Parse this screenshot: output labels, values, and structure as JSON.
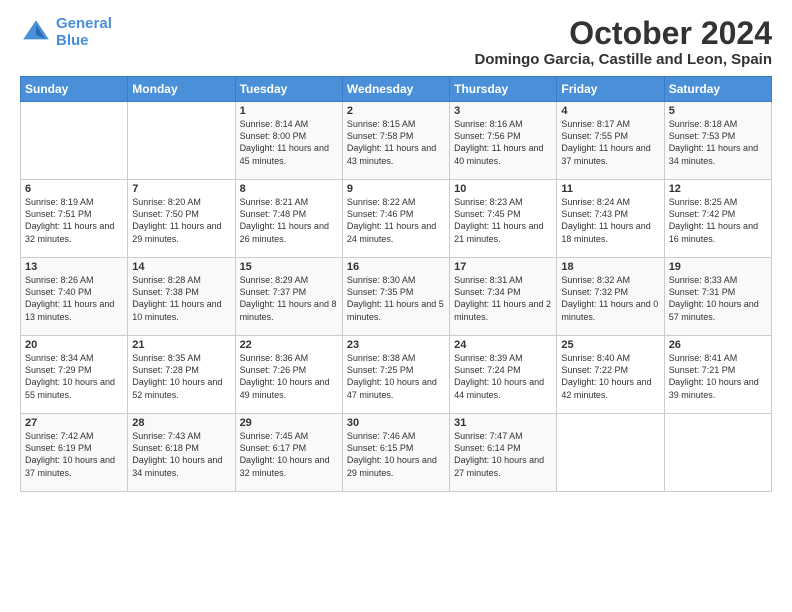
{
  "header": {
    "logo_line1": "General",
    "logo_line2": "Blue",
    "title": "October 2024",
    "subtitle": "Domingo Garcia, Castille and Leon, Spain"
  },
  "weekdays": [
    "Sunday",
    "Monday",
    "Tuesday",
    "Wednesday",
    "Thursday",
    "Friday",
    "Saturday"
  ],
  "weeks": [
    [
      {
        "day": "",
        "sunrise": "",
        "sunset": "",
        "daylight": ""
      },
      {
        "day": "",
        "sunrise": "",
        "sunset": "",
        "daylight": ""
      },
      {
        "day": "1",
        "sunrise": "Sunrise: 8:14 AM",
        "sunset": "Sunset: 8:00 PM",
        "daylight": "Daylight: 11 hours and 45 minutes."
      },
      {
        "day": "2",
        "sunrise": "Sunrise: 8:15 AM",
        "sunset": "Sunset: 7:58 PM",
        "daylight": "Daylight: 11 hours and 43 minutes."
      },
      {
        "day": "3",
        "sunrise": "Sunrise: 8:16 AM",
        "sunset": "Sunset: 7:56 PM",
        "daylight": "Daylight: 11 hours and 40 minutes."
      },
      {
        "day": "4",
        "sunrise": "Sunrise: 8:17 AM",
        "sunset": "Sunset: 7:55 PM",
        "daylight": "Daylight: 11 hours and 37 minutes."
      },
      {
        "day": "5",
        "sunrise": "Sunrise: 8:18 AM",
        "sunset": "Sunset: 7:53 PM",
        "daylight": "Daylight: 11 hours and 34 minutes."
      }
    ],
    [
      {
        "day": "6",
        "sunrise": "Sunrise: 8:19 AM",
        "sunset": "Sunset: 7:51 PM",
        "daylight": "Daylight: 11 hours and 32 minutes."
      },
      {
        "day": "7",
        "sunrise": "Sunrise: 8:20 AM",
        "sunset": "Sunset: 7:50 PM",
        "daylight": "Daylight: 11 hours and 29 minutes."
      },
      {
        "day": "8",
        "sunrise": "Sunrise: 8:21 AM",
        "sunset": "Sunset: 7:48 PM",
        "daylight": "Daylight: 11 hours and 26 minutes."
      },
      {
        "day": "9",
        "sunrise": "Sunrise: 8:22 AM",
        "sunset": "Sunset: 7:46 PM",
        "daylight": "Daylight: 11 hours and 24 minutes."
      },
      {
        "day": "10",
        "sunrise": "Sunrise: 8:23 AM",
        "sunset": "Sunset: 7:45 PM",
        "daylight": "Daylight: 11 hours and 21 minutes."
      },
      {
        "day": "11",
        "sunrise": "Sunrise: 8:24 AM",
        "sunset": "Sunset: 7:43 PM",
        "daylight": "Daylight: 11 hours and 18 minutes."
      },
      {
        "day": "12",
        "sunrise": "Sunrise: 8:25 AM",
        "sunset": "Sunset: 7:42 PM",
        "daylight": "Daylight: 11 hours and 16 minutes."
      }
    ],
    [
      {
        "day": "13",
        "sunrise": "Sunrise: 8:26 AM",
        "sunset": "Sunset: 7:40 PM",
        "daylight": "Daylight: 11 hours and 13 minutes."
      },
      {
        "day": "14",
        "sunrise": "Sunrise: 8:28 AM",
        "sunset": "Sunset: 7:38 PM",
        "daylight": "Daylight: 11 hours and 10 minutes."
      },
      {
        "day": "15",
        "sunrise": "Sunrise: 8:29 AM",
        "sunset": "Sunset: 7:37 PM",
        "daylight": "Daylight: 11 hours and 8 minutes."
      },
      {
        "day": "16",
        "sunrise": "Sunrise: 8:30 AM",
        "sunset": "Sunset: 7:35 PM",
        "daylight": "Daylight: 11 hours and 5 minutes."
      },
      {
        "day": "17",
        "sunrise": "Sunrise: 8:31 AM",
        "sunset": "Sunset: 7:34 PM",
        "daylight": "Daylight: 11 hours and 2 minutes."
      },
      {
        "day": "18",
        "sunrise": "Sunrise: 8:32 AM",
        "sunset": "Sunset: 7:32 PM",
        "daylight": "Daylight: 11 hours and 0 minutes."
      },
      {
        "day": "19",
        "sunrise": "Sunrise: 8:33 AM",
        "sunset": "Sunset: 7:31 PM",
        "daylight": "Daylight: 10 hours and 57 minutes."
      }
    ],
    [
      {
        "day": "20",
        "sunrise": "Sunrise: 8:34 AM",
        "sunset": "Sunset: 7:29 PM",
        "daylight": "Daylight: 10 hours and 55 minutes."
      },
      {
        "day": "21",
        "sunrise": "Sunrise: 8:35 AM",
        "sunset": "Sunset: 7:28 PM",
        "daylight": "Daylight: 10 hours and 52 minutes."
      },
      {
        "day": "22",
        "sunrise": "Sunrise: 8:36 AM",
        "sunset": "Sunset: 7:26 PM",
        "daylight": "Daylight: 10 hours and 49 minutes."
      },
      {
        "day": "23",
        "sunrise": "Sunrise: 8:38 AM",
        "sunset": "Sunset: 7:25 PM",
        "daylight": "Daylight: 10 hours and 47 minutes."
      },
      {
        "day": "24",
        "sunrise": "Sunrise: 8:39 AM",
        "sunset": "Sunset: 7:24 PM",
        "daylight": "Daylight: 10 hours and 44 minutes."
      },
      {
        "day": "25",
        "sunrise": "Sunrise: 8:40 AM",
        "sunset": "Sunset: 7:22 PM",
        "daylight": "Daylight: 10 hours and 42 minutes."
      },
      {
        "day": "26",
        "sunrise": "Sunrise: 8:41 AM",
        "sunset": "Sunset: 7:21 PM",
        "daylight": "Daylight: 10 hours and 39 minutes."
      }
    ],
    [
      {
        "day": "27",
        "sunrise": "Sunrise: 7:42 AM",
        "sunset": "Sunset: 6:19 PM",
        "daylight": "Daylight: 10 hours and 37 minutes."
      },
      {
        "day": "28",
        "sunrise": "Sunrise: 7:43 AM",
        "sunset": "Sunset: 6:18 PM",
        "daylight": "Daylight: 10 hours and 34 minutes."
      },
      {
        "day": "29",
        "sunrise": "Sunrise: 7:45 AM",
        "sunset": "Sunset: 6:17 PM",
        "daylight": "Daylight: 10 hours and 32 minutes."
      },
      {
        "day": "30",
        "sunrise": "Sunrise: 7:46 AM",
        "sunset": "Sunset: 6:15 PM",
        "daylight": "Daylight: 10 hours and 29 minutes."
      },
      {
        "day": "31",
        "sunrise": "Sunrise: 7:47 AM",
        "sunset": "Sunset: 6:14 PM",
        "daylight": "Daylight: 10 hours and 27 minutes."
      },
      {
        "day": "",
        "sunrise": "",
        "sunset": "",
        "daylight": ""
      },
      {
        "day": "",
        "sunrise": "",
        "sunset": "",
        "daylight": ""
      }
    ]
  ]
}
